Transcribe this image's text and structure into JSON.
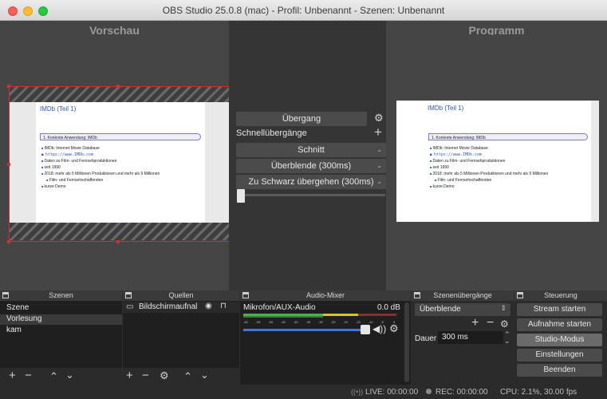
{
  "window": {
    "title": "OBS Studio 25.0.8 (mac) - Profil: Unbenannt - Szenen: Unbenannt"
  },
  "preview": {
    "left_label": "Vorschau",
    "right_label": "Programm"
  },
  "slide": {
    "title": "IMDb (Teil 1)",
    "box": "1. Konkrete Anwendung: IMDb",
    "bullets": [
      "IMDb: Internet Movie Database",
      "https://www.IMDb.com",
      "Daten zu Film- und Fernsehproduktionen",
      "seit 1990",
      "2018: mehr als 5 Millionen Produktionen und mehr als 9 Millionen",
      "Film- und Fernsehschaffenden",
      "kurze Demo"
    ]
  },
  "transition": {
    "button_label": "Übergang",
    "quick_label": "Schnellübergänge",
    "options": [
      "Schnitt",
      "Überblende (300ms)",
      "Zu Schwarz übergehen (300ms)"
    ]
  },
  "docks": {
    "scenes": {
      "title": "Szenen",
      "items": [
        "Szene",
        "Vorlesung",
        "kam"
      ],
      "selected_index": 1
    },
    "sources": {
      "title": "Quellen",
      "items": [
        "Bildschirmaufnal"
      ]
    },
    "mixer": {
      "title": "Audio-Mixer",
      "channel": "Mikrofon/AUX-Audio",
      "level": "0.0 dB",
      "scale": [
        "-60",
        "-55",
        "-50",
        "-45",
        "-40",
        "-35",
        "-30",
        "-25",
        "-20",
        "-15",
        "-10",
        "-5",
        "0"
      ]
    },
    "scene_transitions": {
      "title": "Szenenübergänge",
      "selected": "Überblende",
      "duration_label": "Dauer",
      "duration_value": "300 ms"
    },
    "controls": {
      "title": "Steuerung",
      "buttons": [
        "Stream starten",
        "Aufnahme starten",
        "Studio-Modus",
        "Einstellungen",
        "Beenden"
      ],
      "active_index": 2
    }
  },
  "status": {
    "live": "LIVE: 00:00:00",
    "rec": "REC: 00:00:00",
    "cpu": "CPU: 2.1%, 30.00 fps"
  },
  "colors": {
    "accent_blue": "#3d7bd8",
    "selection_red": "#d03030",
    "meter_green": "#4caf50",
    "meter_yellow": "#d4c32a"
  }
}
